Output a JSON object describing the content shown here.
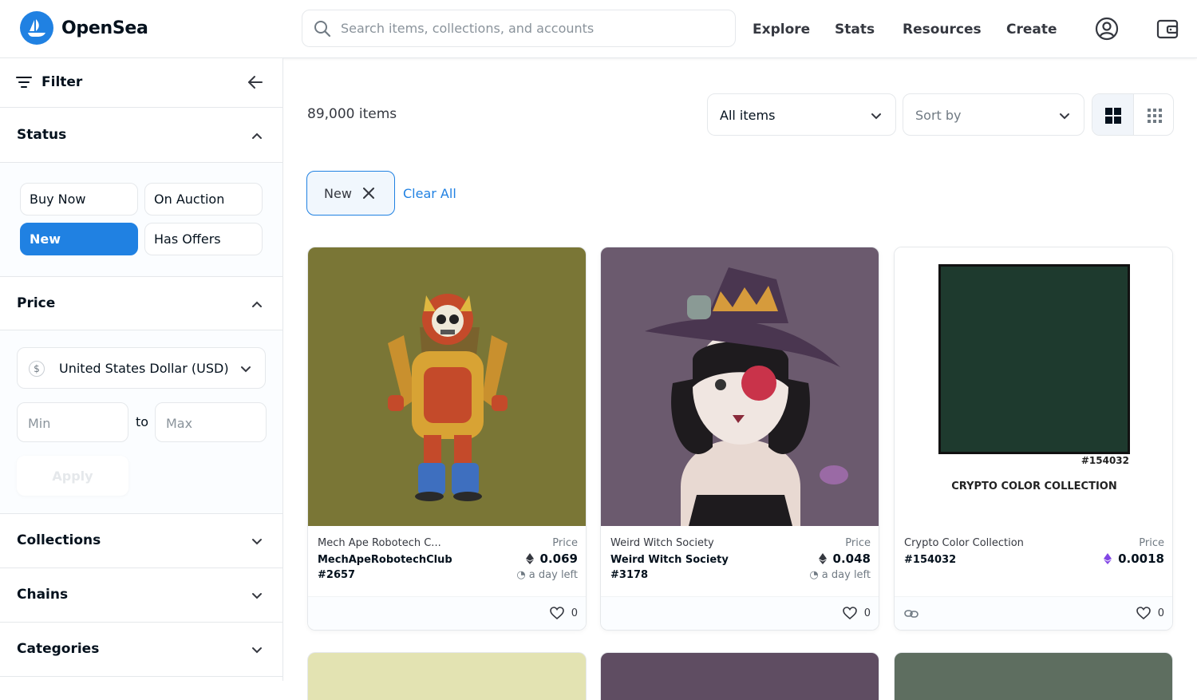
{
  "header": {
    "brand": "OpenSea",
    "search_placeholder": "Search items, collections, and accounts",
    "nav": [
      "Explore",
      "Stats",
      "Resources",
      "Create"
    ],
    "accent": "#2081e2"
  },
  "sidebar": {
    "filter_title": "Filter",
    "status": {
      "title": "Status",
      "options": [
        {
          "label": "Buy Now",
          "active": false
        },
        {
          "label": "On Auction",
          "active": false
        },
        {
          "label": "New",
          "active": true
        },
        {
          "label": "Has Offers",
          "active": false
        }
      ]
    },
    "price": {
      "title": "Price",
      "currency_symbol": "$",
      "currency": "United States Dollar (USD)",
      "min_placeholder": "Min",
      "to_label": "to",
      "max_placeholder": "Max",
      "apply_label": "Apply"
    },
    "collections_title": "Collections",
    "chains_title": "Chains",
    "categories_title": "Categories"
  },
  "main": {
    "item_count": "89,000 items",
    "item_filter": "All items",
    "sort_label": "Sort by",
    "active_filter": "New",
    "clear_all": "Clear All",
    "cards": [
      {
        "collection": "Mech Ape Robotech C...",
        "name": "MechApeRobotechClub #2657",
        "price_label": "Price",
        "price": "0.069",
        "time_left": "a day left",
        "likes": "0",
        "bg": "#7a7636"
      },
      {
        "collection": "Weird Witch Society",
        "name": "Weird Witch Society #3178",
        "price_label": "Price",
        "price": "0.048",
        "time_left": "a day left",
        "likes": "0",
        "bg": "#6b5a6e"
      },
      {
        "collection": "Crypto Color Collection",
        "name": "#154032",
        "price_label": "Price",
        "price": "0.0018",
        "likes": "0",
        "bg": "#ffffff",
        "swatch_color": "#1e3a2e",
        "image_id": "#154032",
        "image_caption": "CRYPTO COLOR COLLECTION"
      }
    ],
    "next_row_colors": [
      "#e3e3b2",
      "#5f4d62",
      "#5e6e60"
    ]
  }
}
